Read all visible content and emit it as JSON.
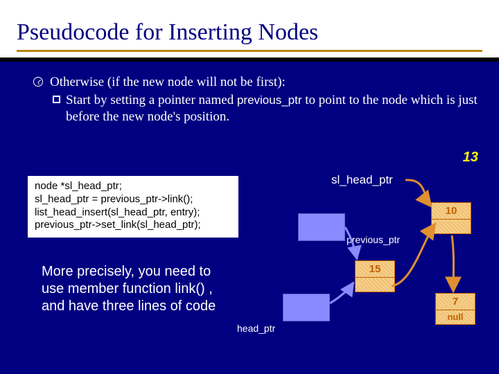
{
  "title": "Pseudocode for Inserting Nodes",
  "bullet": {
    "main": "Otherwise (if the new node will not be first):",
    "sub_prefix": "Start by setting a pointer named ",
    "sub_code": "previous_ptr",
    "sub_suffix": " to point to the node which is just before the new node's position."
  },
  "code": {
    "l1": "node *sl_head_ptr;",
    "l2": "sl_head_ptr = previous_ptr->link();",
    "l3": "list_head_insert(sl_head_ptr, entry);",
    "l4": "previous_ptr->set_link(sl_head_ptr);"
  },
  "precise": "More precisely, you need to use member function link() , and have three lines of code",
  "diagram": {
    "sl_head_ptr_label": "sl_head_ptr",
    "previous_ptr_label": "previous_ptr",
    "head_ptr_label": "head_ptr",
    "node_13": "13",
    "node_10": "10",
    "node_15": "15",
    "node_7": "7",
    "node_null": "null"
  }
}
